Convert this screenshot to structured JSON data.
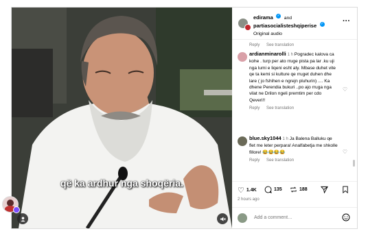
{
  "video": {
    "caption": "që ka ardhur nga shoqëria."
  },
  "post": {
    "author": "edirama",
    "and_text": "and",
    "coauthor": "partiasocialisteshqiperise",
    "audio": "Original audio",
    "first_meta": {
      "reply": "Reply",
      "translation": "See translation"
    }
  },
  "comments": [
    {
      "user": "ardianminarolli",
      "time": "1 h",
      "text": "Pogradec kalova ca kohe . turp per ato rruge pista pa lar .ku uji nga lumi e liqeni esht aty. Mbase duhet vite qe ta kemi si kulture qe rruget duhen dhe lare ( jo fshihen e ngrejn pluhurin) .... Ka dhene Perendia bukuri ..po ajo rruga nga vilat ne Drilon ngeli premtim per cdo Qeveri!!",
      "reply": "Reply",
      "translation": "See translation"
    },
    {
      "user": "blue.sky1044",
      "time": "1 h",
      "text": "Ja Balena Balluku qe flet me leter perpara! Analfabetja me shkolle fillore! 😂😂😂😂",
      "reply": "Reply",
      "translation": "See translation"
    }
  ],
  "actions": {
    "likes": "1.4K",
    "comments": "135",
    "shares": "188",
    "time_ago": "2 hours ago"
  },
  "add_comment": {
    "placeholder": "Add a comment…"
  },
  "icons": {
    "more": "more-horizontal-icon",
    "heart": "heart-outline-icon",
    "comment": "comment-bubble-icon",
    "repost": "repost-icon",
    "share": "send-icon",
    "save": "bookmark-icon",
    "emoji": "emoji-icon",
    "mute": "speaker-muted-icon",
    "tag": "user-tag-icon"
  }
}
